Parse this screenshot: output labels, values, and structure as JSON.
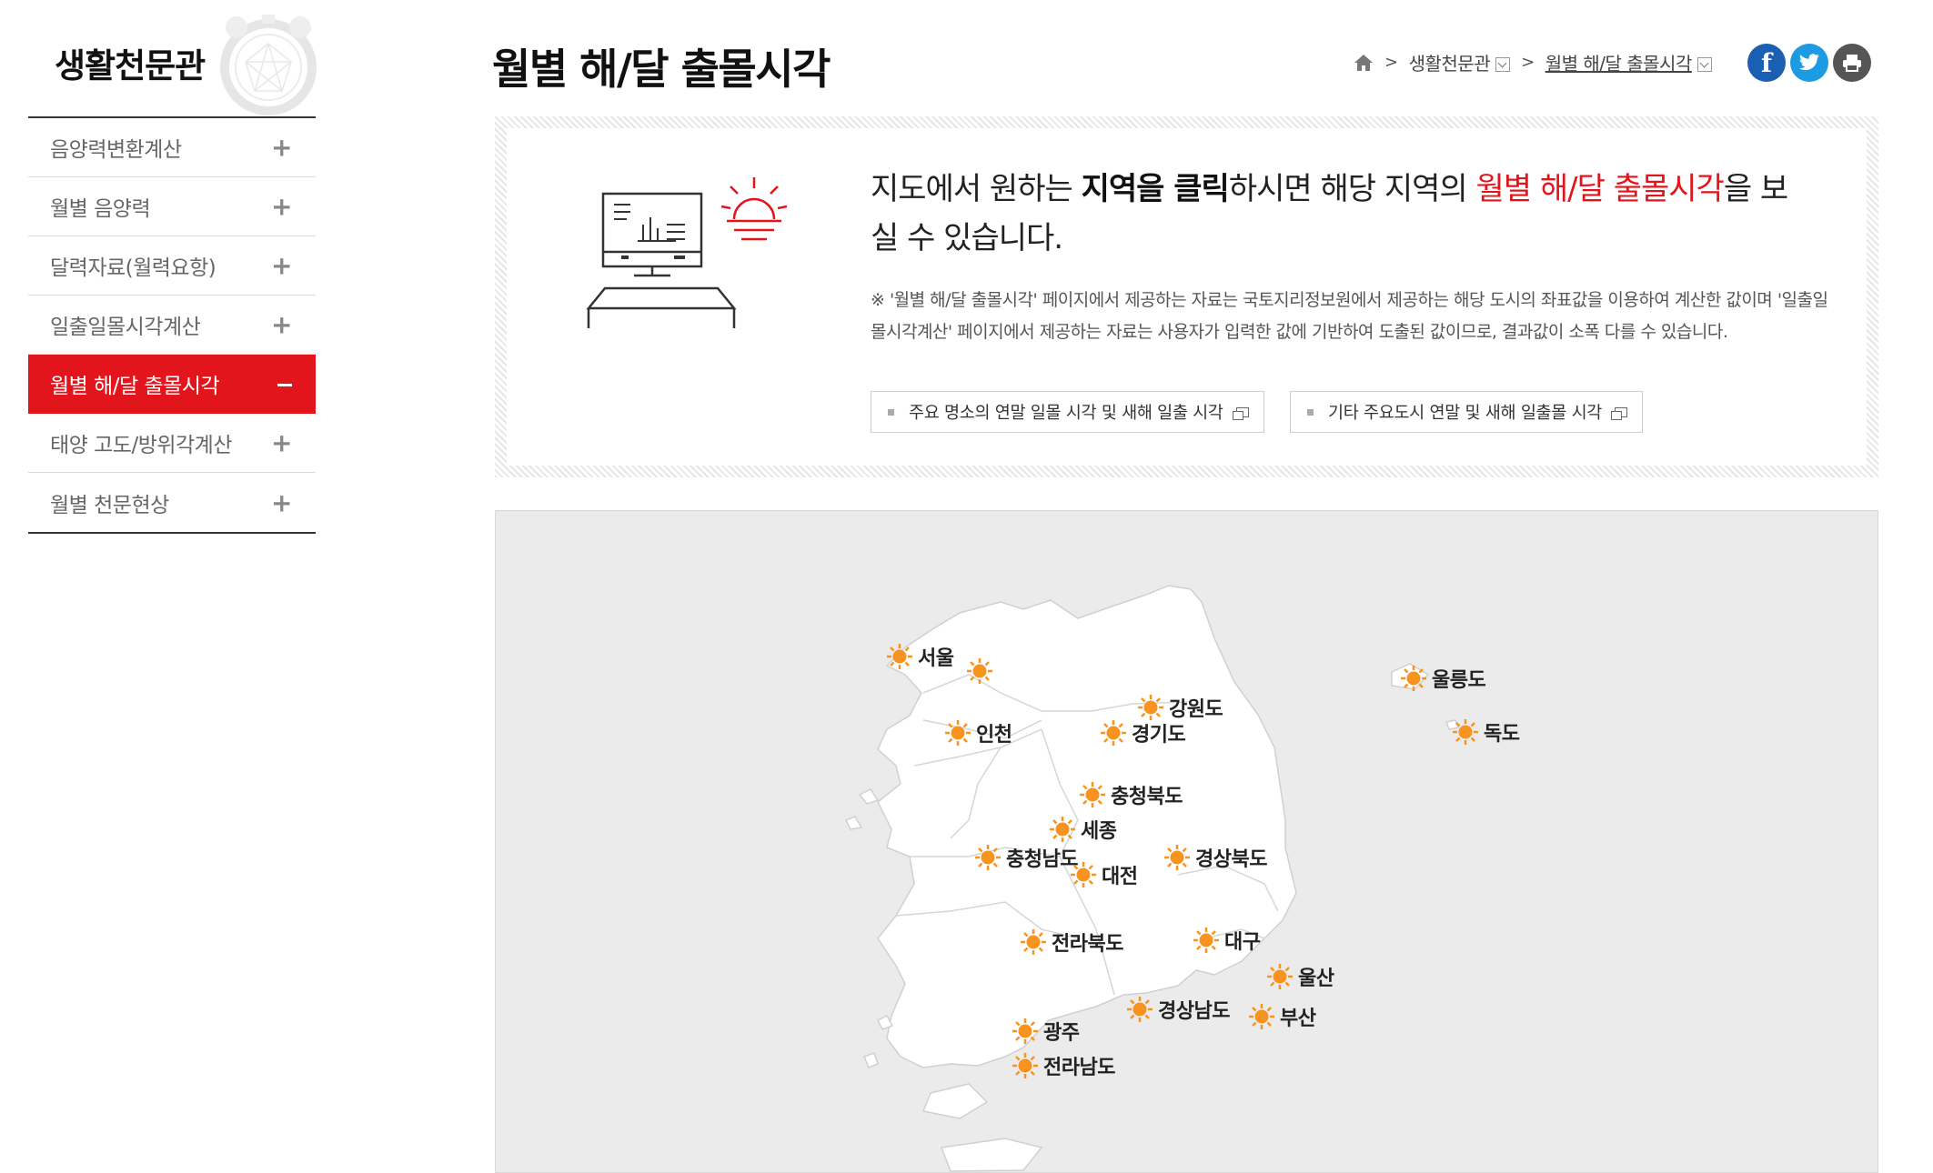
{
  "sidebar": {
    "title": "생활천문관",
    "items": [
      {
        "label": "음양력변환계산",
        "icon": "plus-icon"
      },
      {
        "label": "월별 음양력",
        "icon": "plus-icon"
      },
      {
        "label": "달력자료(월력요항)",
        "icon": "plus-icon"
      },
      {
        "label": "일출일몰시각계산",
        "icon": "plus-icon"
      },
      {
        "label": "월별 해/달 출몰시각",
        "icon": "minus-icon",
        "active": true
      },
      {
        "label": "태양 고도/방위각계산",
        "icon": "plus-icon"
      },
      {
        "label": "월별 천문현상",
        "icon": "plus-icon"
      }
    ],
    "accent_color": "#e2141c"
  },
  "header": {
    "page_title": "월별 해/달 출몰시각",
    "breadcrumb": {
      "home_icon": "home-icon",
      "level1": "생활천문관",
      "level2": "월별 해/달 출몰시각"
    },
    "share": {
      "facebook_label": "f",
      "twitter_icon": "twitter-icon",
      "print_icon": "print-icon"
    }
  },
  "info": {
    "lead_1": "지도에서 원하는 ",
    "lead_bold": "지역을 클릭",
    "lead_2": "하시면 해당 지역의 ",
    "lead_red": "월별 해/달 출몰시각",
    "lead_3": "을 보실 수 있습니다.",
    "note": "※ '월별 해/달 출몰시각' 페이지에서 제공하는 자료는 국토지리정보원에서 제공하는 해당 도시의 좌표값을 이용하여 계산한 값이며 '일출일몰시각계산' 페이지에서 제공하는 자료는 사용자가 입력한 값에 기반하여 도출된 값이므로, 결과값이 소폭 다를 수 있습니다.",
    "button_1": "주요 명소의 연말 일몰 시각 및 새해 일출 시각",
    "button_2": "기타 주요도시 연말 및 새해 일출몰 시각"
  },
  "map": {
    "regions": [
      {
        "name": "서울"
      },
      {
        "name": "강원도"
      },
      {
        "name": "인천"
      },
      {
        "name": "경기도"
      },
      {
        "name": "울릉도"
      },
      {
        "name": "독도"
      },
      {
        "name": "충청북도"
      },
      {
        "name": "세종"
      },
      {
        "name": "충청남도"
      },
      {
        "name": "경상북도"
      },
      {
        "name": "대전"
      },
      {
        "name": "전라북도"
      },
      {
        "name": "대구"
      },
      {
        "name": "울산"
      },
      {
        "name": "경상남도"
      },
      {
        "name": "부산"
      },
      {
        "name": "광주"
      },
      {
        "name": "전라남도"
      }
    ],
    "marker_icon": "sun-icon",
    "marker_color": "#f7931e",
    "land_color": "#ffffff",
    "sea_color": "#ebebeb"
  }
}
